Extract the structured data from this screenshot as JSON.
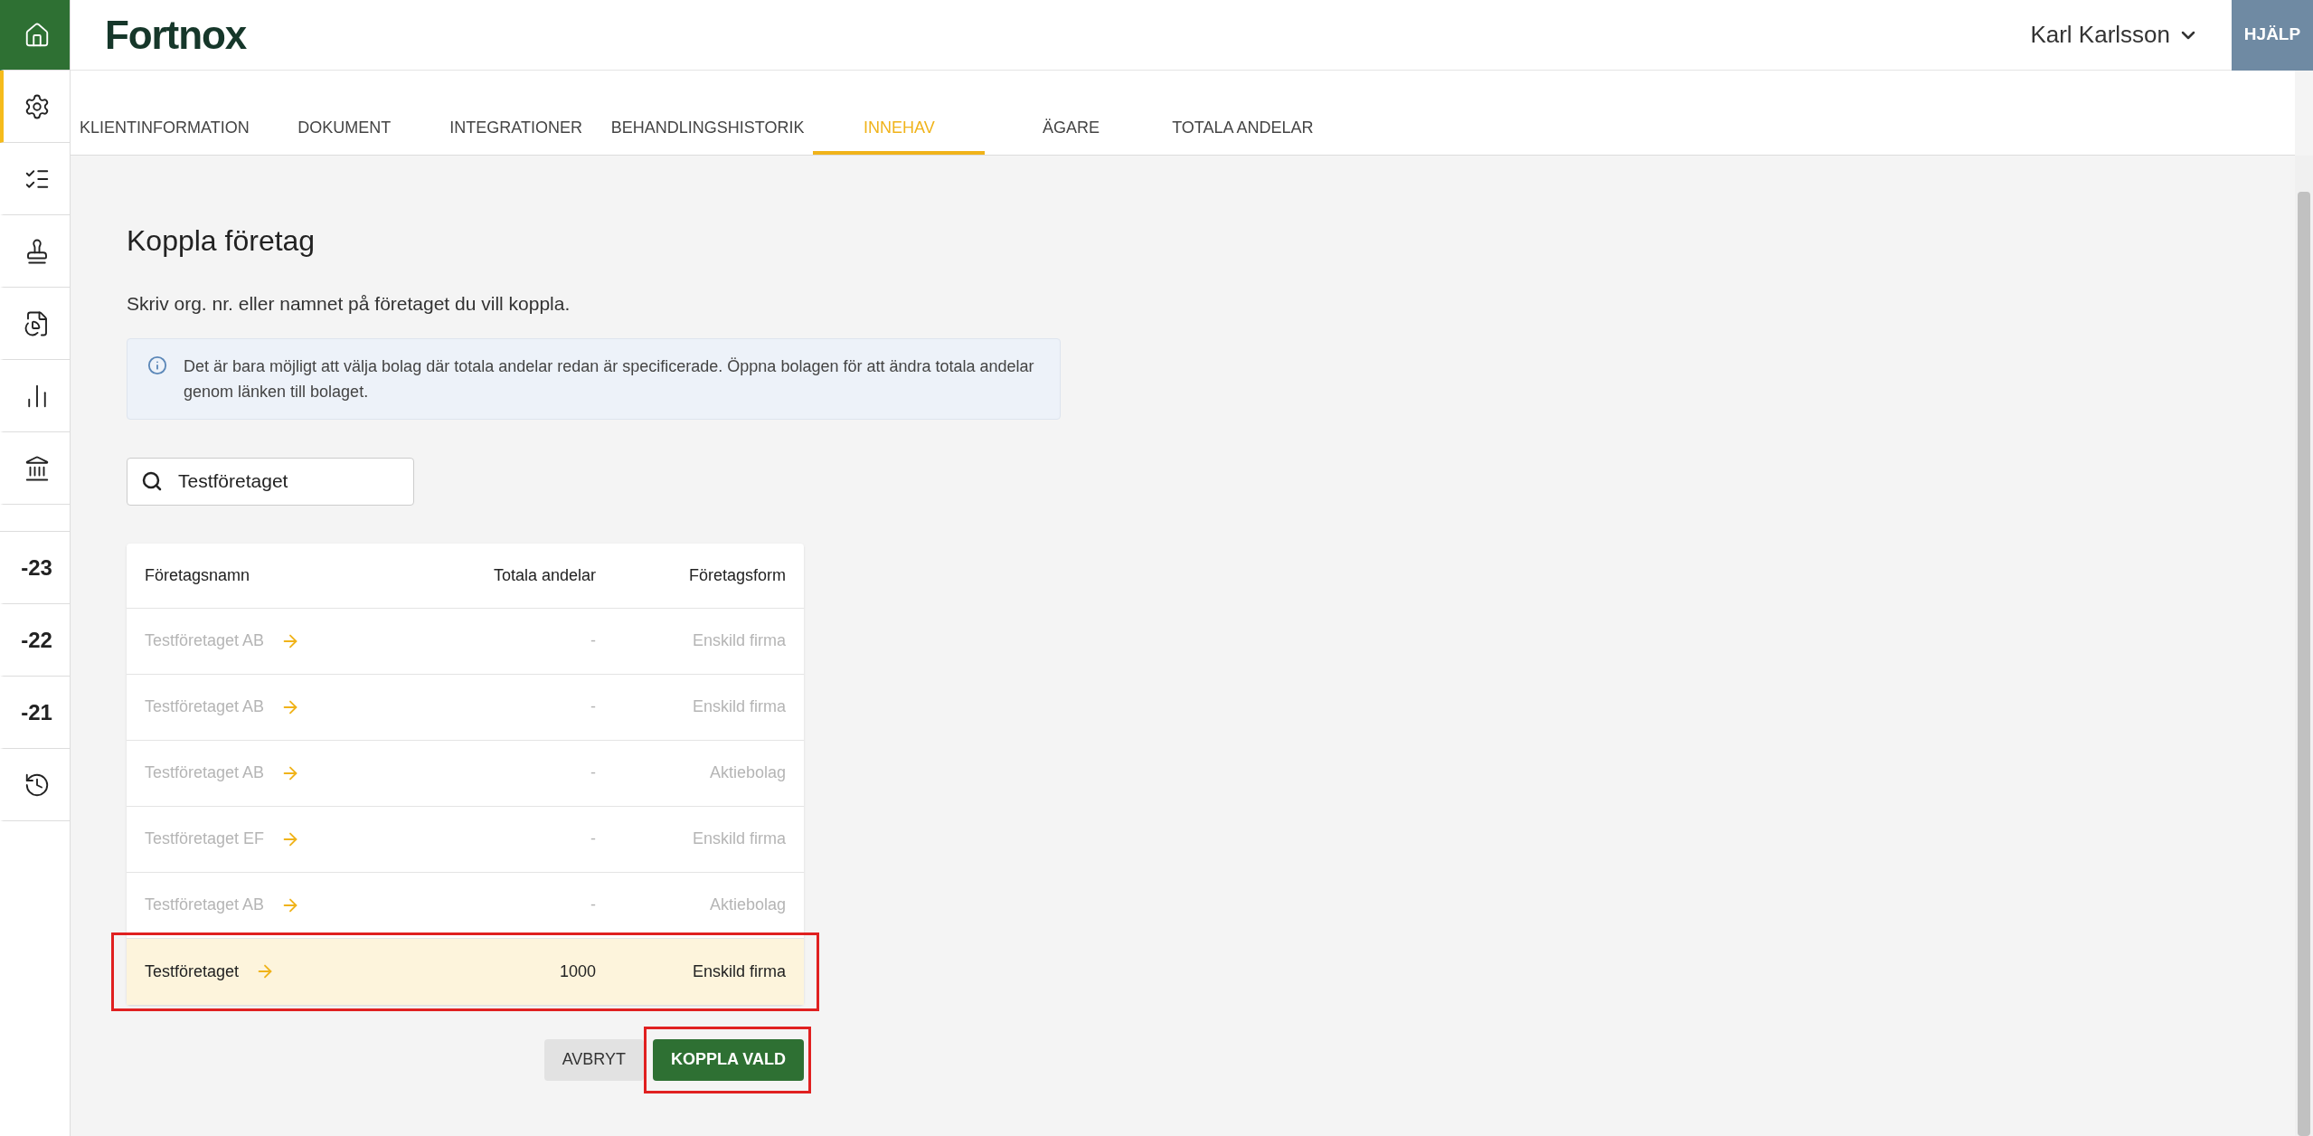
{
  "logo": "Fortnox",
  "user": {
    "name": "Karl Karlsson"
  },
  "help_button": "HJÄLP",
  "sidebar": [
    {
      "kind": "icon",
      "selected": false
    },
    {
      "kind": "icon",
      "selected": true
    },
    {
      "kind": "icon",
      "selected": false
    },
    {
      "kind": "icon",
      "selected": false
    },
    {
      "kind": "icon",
      "selected": false
    },
    {
      "kind": "icon",
      "selected": false
    },
    {
      "kind": "icon",
      "selected": false
    },
    {
      "kind": "gap"
    },
    {
      "kind": "year",
      "label": "-23",
      "selected": false
    },
    {
      "kind": "year",
      "label": "-22",
      "selected": false
    },
    {
      "kind": "year",
      "label": "-21",
      "selected": false
    },
    {
      "kind": "icon",
      "selected": false
    }
  ],
  "tabs": [
    {
      "label": "KLIENTINFORMATION",
      "selected": false
    },
    {
      "label": "DOKUMENT",
      "selected": false
    },
    {
      "label": "INTEGRATIONER",
      "selected": false
    },
    {
      "label": "BEHANDLINGSHISTORIK",
      "selected": false
    },
    {
      "label": "INNEHAV",
      "selected": true
    },
    {
      "label": "ÄGARE",
      "selected": false
    },
    {
      "label": "TOTALA ANDELAR",
      "selected": false
    }
  ],
  "title": "Koppla företag",
  "description": "Skriv org. nr. eller namnet på företaget du vill koppla.",
  "info": "Det är bara möjligt att välja bolag där totala andelar redan är specificerade. Öppna bolagen för att ändra totala andelar genom länken till bolaget.",
  "search": {
    "value": "Testföretaget"
  },
  "table": {
    "columns": [
      "Företagsnamn",
      "Totala andelar",
      "Företagsform"
    ],
    "rows": [
      {
        "name": "Testföretaget AB",
        "shares": "-",
        "form": "Enskild firma",
        "disabled": true,
        "selected": false
      },
      {
        "name": "Testföretaget AB",
        "shares": "-",
        "form": "Enskild firma",
        "disabled": true,
        "selected": false
      },
      {
        "name": "Testföretaget AB",
        "shares": "-",
        "form": "Aktiebolag",
        "disabled": true,
        "selected": false
      },
      {
        "name": "Testföretaget EF",
        "shares": "-",
        "form": "Enskild firma",
        "disabled": true,
        "selected": false
      },
      {
        "name": "Testföretaget AB",
        "shares": "-",
        "form": "Aktiebolag",
        "disabled": true,
        "selected": false
      },
      {
        "name": "Testföretaget",
        "shares": "1000",
        "form": "Enskild firma",
        "disabled": false,
        "selected": true,
        "highlighted": true
      }
    ]
  },
  "buttons": [
    {
      "label": "AVBRYT",
      "kind": "secondary",
      "highlighted": false
    },
    {
      "label": "KOPPLA VALD",
      "kind": "primary",
      "highlighted": true
    }
  ]
}
